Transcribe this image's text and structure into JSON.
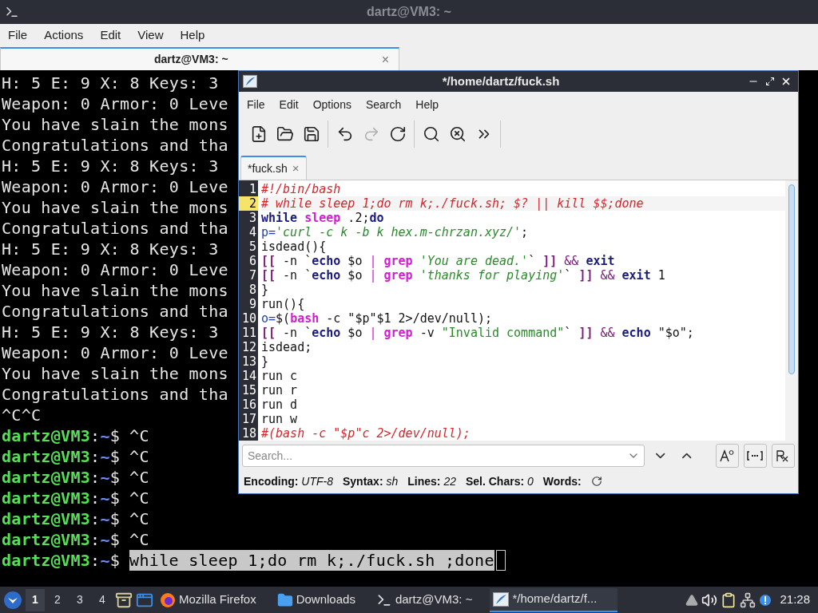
{
  "terminal": {
    "title": "dartz@VM3: ~",
    "menu": [
      "File",
      "Actions",
      "Edit",
      "View",
      "Help"
    ],
    "tab": {
      "label": "dartz@VM3: ~",
      "close": "×",
      "selected": true
    },
    "output": [
      "H: 5 E: 9 X: 8 Keys: 3",
      "Weapon: 0 Armor: 0 Leve",
      "You have slain the mons",
      "Congratulations and tha",
      "H: 5 E: 9 X: 8 Keys: 3",
      "Weapon: 0 Armor: 0 Leve",
      "You have slain the mons",
      "Congratulations and tha",
      "H: 5 E: 9 X: 8 Keys: 3",
      "Weapon: 0 Armor: 0 Leve",
      "You have slain the mons",
      "Congratulations and tha",
      "H: 5 E: 9 X: 8 Keys: 3",
      "Weapon: 0 Armor: 0 Leve",
      "You have slain the mons",
      "Congratulations and tha",
      "^C^C"
    ],
    "prompts": [
      {
        "user": "dartz@VM3",
        "sep": ":",
        "path": "~",
        "sign": "$",
        "command": "^C",
        "selected": false
      },
      {
        "user": "dartz@VM3",
        "sep": ":",
        "path": "~",
        "sign": "$",
        "command": "^C",
        "selected": false
      },
      {
        "user": "dartz@VM3",
        "sep": ":",
        "path": "~",
        "sign": "$",
        "command": "^C",
        "selected": false
      },
      {
        "user": "dartz@VM3",
        "sep": ":",
        "path": "~",
        "sign": "$",
        "command": "^C",
        "selected": false
      },
      {
        "user": "dartz@VM3",
        "sep": ":",
        "path": "~",
        "sign": "$",
        "command": "^C",
        "selected": false
      },
      {
        "user": "dartz@VM3",
        "sep": ":",
        "path": "~",
        "sign": "$",
        "command": "^C",
        "selected": false
      },
      {
        "user": "dartz@VM3",
        "sep": ":",
        "path": "~",
        "sign": "$",
        "command": "while sleep 1;do rm k;./fuck.sh ;done",
        "selected": true
      }
    ]
  },
  "editor": {
    "title": "*/home/dartz/fuck.sh",
    "menu": [
      "File",
      "Edit",
      "Options",
      "Search",
      "Help"
    ],
    "toolbar": [
      {
        "kind": "new",
        "disabled": false
      },
      {
        "kind": "open",
        "disabled": false
      },
      {
        "kind": "save",
        "disabled": false
      },
      {
        "kind": "sep"
      },
      {
        "kind": "undo",
        "disabled": false
      },
      {
        "kind": "redo",
        "disabled": true
      },
      {
        "kind": "reload",
        "disabled": false
      },
      {
        "kind": "sep"
      },
      {
        "kind": "find",
        "disabled": false
      },
      {
        "kind": "replace",
        "disabled": false
      },
      {
        "kind": "more",
        "disabled": false
      },
      {
        "kind": "sep"
      }
    ],
    "tab": {
      "label": "*fuck.sh",
      "close": "×",
      "selected": true
    },
    "lines": [
      {
        "number": "1",
        "current": false,
        "tokens": [
          {
            "text": "#!/bin/bash",
            "kind": "comment"
          }
        ]
      },
      {
        "number": "2",
        "current": true,
        "tokens": [
          {
            "text": "# while sleep 1;do rm k;./fuck.sh; $? || kill $$;done",
            "kind": "comment"
          }
        ]
      },
      {
        "number": "3",
        "current": false,
        "tokens": [
          {
            "text": "while",
            "kind": "keyword"
          },
          {
            "text": " sleep",
            "kind": "builtin"
          },
          {
            "text": " .2;",
            "kind": "plain"
          },
          {
            "text": "do",
            "kind": "keyword"
          }
        ]
      },
      {
        "number": "4",
        "current": false,
        "tokens": [
          {
            "text": "p=",
            "kind": "variable"
          },
          {
            "text": "'curl -c k -b k hex.m-chrzan.xyz/'",
            "kind": "string"
          },
          {
            "text": ";",
            "kind": "plain"
          }
        ]
      },
      {
        "number": "5",
        "current": false,
        "tokens": [
          {
            "text": "isdead(){",
            "kind": "plain"
          }
        ]
      },
      {
        "number": "6",
        "current": false,
        "tokens": [
          {
            "text": "[[",
            "kind": "bracket"
          },
          {
            "text": " -n `",
            "kind": "plain"
          },
          {
            "text": "echo",
            "kind": "keyword"
          },
          {
            "text": " $o ",
            "kind": "plain"
          },
          {
            "text": "| ",
            "kind": "operator"
          },
          {
            "text": "grep",
            "kind": "builtin"
          },
          {
            "text": " 'You are dead.'",
            "kind": "string"
          },
          {
            "text": "` ",
            "kind": "plain"
          },
          {
            "text": "]] ",
            "kind": "bracket"
          },
          {
            "text": "&& ",
            "kind": "operator2"
          },
          {
            "text": "exit",
            "kind": "keyword"
          }
        ]
      },
      {
        "number": "7",
        "current": false,
        "tokens": [
          {
            "text": "[[",
            "kind": "bracket"
          },
          {
            "text": " -n `",
            "kind": "plain"
          },
          {
            "text": "echo",
            "kind": "keyword"
          },
          {
            "text": " $o ",
            "kind": "plain"
          },
          {
            "text": "| ",
            "kind": "operator"
          },
          {
            "text": "grep",
            "kind": "builtin"
          },
          {
            "text": " 'thanks for playing'",
            "kind": "string"
          },
          {
            "text": "` ",
            "kind": "plain"
          },
          {
            "text": "]] ",
            "kind": "bracket"
          },
          {
            "text": "&& ",
            "kind": "operator2"
          },
          {
            "text": "exit",
            "kind": "keyword"
          },
          {
            "text": " 1",
            "kind": "plain"
          }
        ]
      },
      {
        "number": "8",
        "current": false,
        "tokens": [
          {
            "text": "}",
            "kind": "plain"
          }
        ]
      },
      {
        "number": "9",
        "current": false,
        "tokens": [
          {
            "text": "run(){",
            "kind": "plain"
          }
        ]
      },
      {
        "number": "10",
        "current": false,
        "tokens": [
          {
            "text": "o=",
            "kind": "variable"
          },
          {
            "text": "$(",
            "kind": "plain"
          },
          {
            "text": "bash",
            "kind": "builtin"
          },
          {
            "text": " -c \"$p\"$1 2>/dev/null);",
            "kind": "plain"
          }
        ]
      },
      {
        "number": "11",
        "current": false,
        "tokens": [
          {
            "text": "[[",
            "kind": "bracket"
          },
          {
            "text": " -n `",
            "kind": "plain"
          },
          {
            "text": "echo",
            "kind": "keyword"
          },
          {
            "text": " $o ",
            "kind": "plain"
          },
          {
            "text": "| ",
            "kind": "operator"
          },
          {
            "text": "grep",
            "kind": "builtin"
          },
          {
            "text": " -v ",
            "kind": "plain"
          },
          {
            "text": "\"Invalid command\"",
            "kind": "dstring"
          },
          {
            "text": "` ",
            "kind": "plain"
          },
          {
            "text": "]] ",
            "kind": "bracket"
          },
          {
            "text": "&& ",
            "kind": "operator2"
          },
          {
            "text": "echo",
            "kind": "keyword"
          },
          {
            "text": " \"$o\";",
            "kind": "plain"
          }
        ]
      },
      {
        "number": "12",
        "current": false,
        "tokens": [
          {
            "text": "isdead;",
            "kind": "plain"
          }
        ]
      },
      {
        "number": "13",
        "current": false,
        "tokens": [
          {
            "text": "}",
            "kind": "plain"
          }
        ]
      },
      {
        "number": "14",
        "current": false,
        "tokens": [
          {
            "text": "run c",
            "kind": "plain"
          }
        ]
      },
      {
        "number": "15",
        "current": false,
        "tokens": [
          {
            "text": "run r",
            "kind": "plain"
          }
        ]
      },
      {
        "number": "16",
        "current": false,
        "tokens": [
          {
            "text": "run d",
            "kind": "plain"
          }
        ]
      },
      {
        "number": "17",
        "current": false,
        "tokens": [
          {
            "text": "run w",
            "kind": "plain"
          }
        ]
      },
      {
        "number": "18",
        "current": false,
        "tokens": [
          {
            "text": "#(bash -c \"$p\"c 2>/dev/null);",
            "kind": "comment"
          }
        ]
      }
    ],
    "search": {
      "placeholder": "Search...",
      "options": [
        {
          "kind": "case"
        },
        {
          "kind": "whole"
        },
        {
          "kind": "regex"
        }
      ]
    },
    "status": [
      {
        "label": "Encoding:",
        "value": "UTF-8"
      },
      {
        "label": "Syntax:",
        "value": "sh"
      },
      {
        "label": "Lines:",
        "value": "22"
      },
      {
        "label": "Sel. Chars:",
        "value": "0"
      },
      {
        "label": "Words:"
      }
    ]
  },
  "taskbar": {
    "workspaces": [
      {
        "label": "1",
        "selected": true
      },
      {
        "label": "2",
        "selected": false
      },
      {
        "label": "3",
        "selected": false
      },
      {
        "label": "4",
        "selected": false
      }
    ],
    "tasks": [
      {
        "kind": "firefox",
        "label": "Mozilla Firefox",
        "selected": false
      },
      {
        "kind": "folder",
        "label": "Downloads",
        "selected": false
      },
      {
        "kind": "terminal",
        "label": "dartz@VM3: ~",
        "selected": false
      },
      {
        "kind": "editor",
        "label": "*/home/dartz/f...",
        "selected": true
      }
    ],
    "clock": "21:28"
  }
}
